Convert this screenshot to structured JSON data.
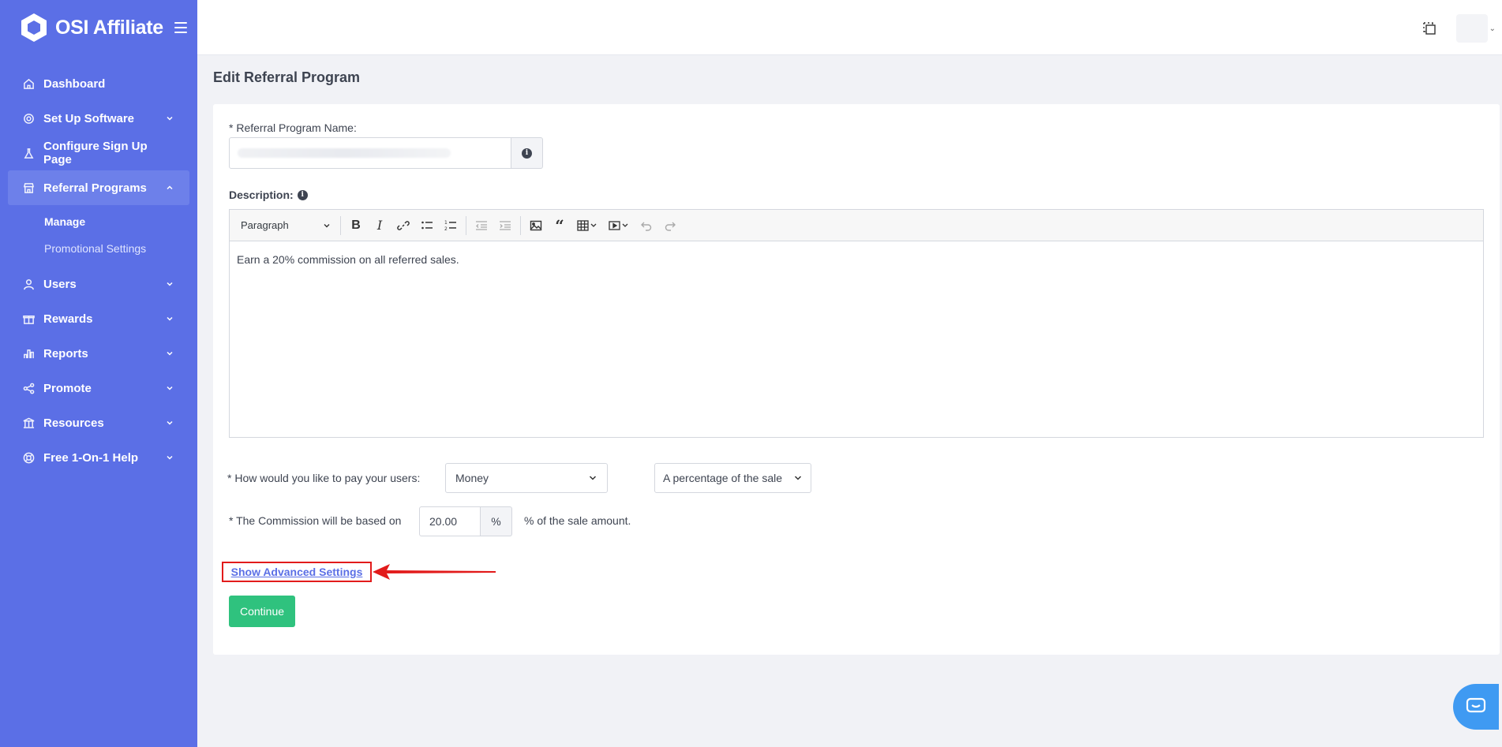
{
  "brand": {
    "name": "OSI Affiliate"
  },
  "nav": {
    "dashboard": "Dashboard",
    "setup": "Set Up Software",
    "signup": "Configure Sign Up Page",
    "referral": "Referral Programs",
    "manage": "Manage",
    "promotional": "Promotional Settings",
    "users": "Users",
    "rewards": "Rewards",
    "reports": "Reports",
    "promote": "Promote",
    "resources": "Resources",
    "help": "Free 1-On-1 Help"
  },
  "page": {
    "title": "Edit Referral Program"
  },
  "form": {
    "name_label": "* Referral Program Name:",
    "description_label": "Description:",
    "editor_block": "Paragraph",
    "description_text": "Earn a 20% commission on all referred sales.",
    "pay_label": "* How would you like to pay your users:",
    "pay_method": "Money",
    "pay_type": "A percentage of the sale",
    "commission_label": "* The Commission will be based on",
    "commission_value": "20.00",
    "commission_unit": "%",
    "commission_suffix": "% of the sale amount.",
    "advanced_link": "Show Advanced Settings",
    "continue": "Continue"
  },
  "colors": {
    "sidebar": "#5b6fe6",
    "accent_green": "#2fc27e",
    "highlight_red": "#e21b1b"
  }
}
